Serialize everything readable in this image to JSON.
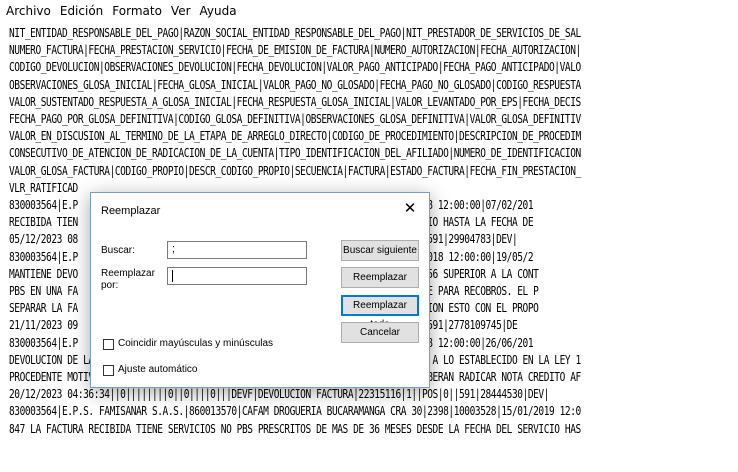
{
  "menu": [
    "Archivo",
    "Edición",
    "Formato",
    "Ver",
    "Ayuda"
  ],
  "lines": [
    "NIT_ENTIDAD_RESPONSABLE_DEL_PAGO|RAZON_SOCIAL_ENTIDAD_RESPONSABLE_DEL_PAGO|NIT_PRESTADOR_DE_SERVICIOS_DE_SAL",
    "NUMERO_FACTURA|FECHA_PRESTACION_SERVICIO|FECHA_DE_EMISION_DE_FACTURA|NUMERO_AUTORIZACION|FECHA_AUTORIZACION|",
    "CODIGO_DEVOLUCION|OBSERVACIONES_DEVOLUCION|FECHA_DEVOLUCION|VALOR_PAGO_ANTICIPADO|FECHA_PAGO_ANTICIPADO|VALO",
    "OBSERVACIONES_GLOSA_INICIAL|FECHA_GLOSA_INICIAL|VALOR_PAGO_NO_GLOSADO|FECHA_PAGO_NO_GLOSADO|CODIGO_RESPUESTA",
    "VALOR_SUSTENTADO_RESPUESTA_A_GLOSA_INICIAL|FECHA_RESPUESTA_GLOSA_INICIAL|VALOR_LEVANTADO_POR_EPS|FECHA_DECIS",
    "FECHA_PAGO_POR_GLOSA_DEFINITIVA|CODIGO_GLOSA_DEFINITIVA|OBSERVACIONES_GLOSA_DEFINITIVA|VALOR_GLOSA_DEFINITIV",
    "VALOR_EN_DISCUSION_AL_TERMINO_DE_LA_ETAPA_DE_ARREGLO_DIRECTO|CODIGO_DE_PROCEDIMIENTO|DESCRIPCION_DE_PROCEDIM",
    "CONSECUTIVO_DE_ATENCION_DE_RADICACION_DE_LA_CUENTA|TIPO_IDENTIFICACION_DEL_AFILIADO|NUMERO_DE_IDENTIFICACION",
    "VALOR_GLOSA_FACTURA|CODIGO_PROPIO|DESCR_CODIGO_PROPIO|SECUENCIA|FACTURA|ESTADO_FACTURA|FECHA_FIN_PRESTACION_",
    "VLR_RATIFICAD",
    "830003564|E.P                                         LE 48|2990|4783|07/02/2018 12:00:00|07/02/201",
    "RECIBIDA TIEN                                         DESDE LA FECHA DEL SERVICIO HASTA LA FECHA DE",
    "05/12/2023 08                                         CTURA|19720772|1||POS|0||591|29904783|DEV|",
    "830003564|E.P                                         LE 48|2778|109745|19/05/2018 12:00:00|19/05/2",
    "MANTIENE DEVO                                         AS VALOR FACTURADO $ 21.856 SUPERIOR A LA CONT",
    "PBS EN UNA FA                                         SOS Y NORMATIVIDAD VIGENTE PARA RECOBROS. EL P",
    "SEPARAR LA FA                                         CTO DE LA GLOSA O DEVOLUCION ESTO CON EL PROPO",
    "21/11/2023 09                                         CTURA|20884907|1||POS|0||591|2778109745|DE",
    "830003564|E.P                                         LE 48|2844|4530|26/06/2018 12:00:00|26/06/201",
    "DEVOLUCION DE LA FACTURA SERVICIOS FACTURADOS CORRESPONDEN AL NO PBS DE ACUERDO A LO ESTABLECIDO EN LA LEY 1",
    "PROCEDENTE MOTIVO POR EL CUAL IPS DEBERA SOLICITAR ANULACION O EN SU DEFECTO DEBERAN RADICAR NOTA CREDITO AF",
    "20/12/2023 04:36:34||0||||||||0||0||||0|||DEVF|DEVOLUCION FACTURA|22315116|1||POS|0||591|28444530|DEV|",
    "830003564|E.P.S. FAMISANAR S.A.S.|860013570|CAFAM DROGUERIA BUCARAMANGA CRA 30|2398|10003528|15/01/2019 12:0",
    "847 LA FACTURA RECIBIDA TIENE SERVICIOS NO PBS PRESCRITOS DE MAS DE 36 MESES DESDE LA FECHA DEL SERVICIO HAS"
  ],
  "dialog": {
    "title": "Reemplazar",
    "close": "✕",
    "buscar_label": "Buscar:",
    "buscar_value": ";",
    "reemplazar_label_1": "Reemplazar",
    "reemplazar_label_2": "por:",
    "reemplazar_value": "",
    "btn_buscar_siguiente": "Buscar siguiente",
    "btn_reemplazar": "Reemplazar",
    "btn_reemplazar_todo": "Reemplazar todo",
    "btn_cancelar": "Cancelar",
    "chk_mayusculas": "Coincidir mayúsculas y minúsculas",
    "chk_ajuste": "Ajuste automático"
  }
}
